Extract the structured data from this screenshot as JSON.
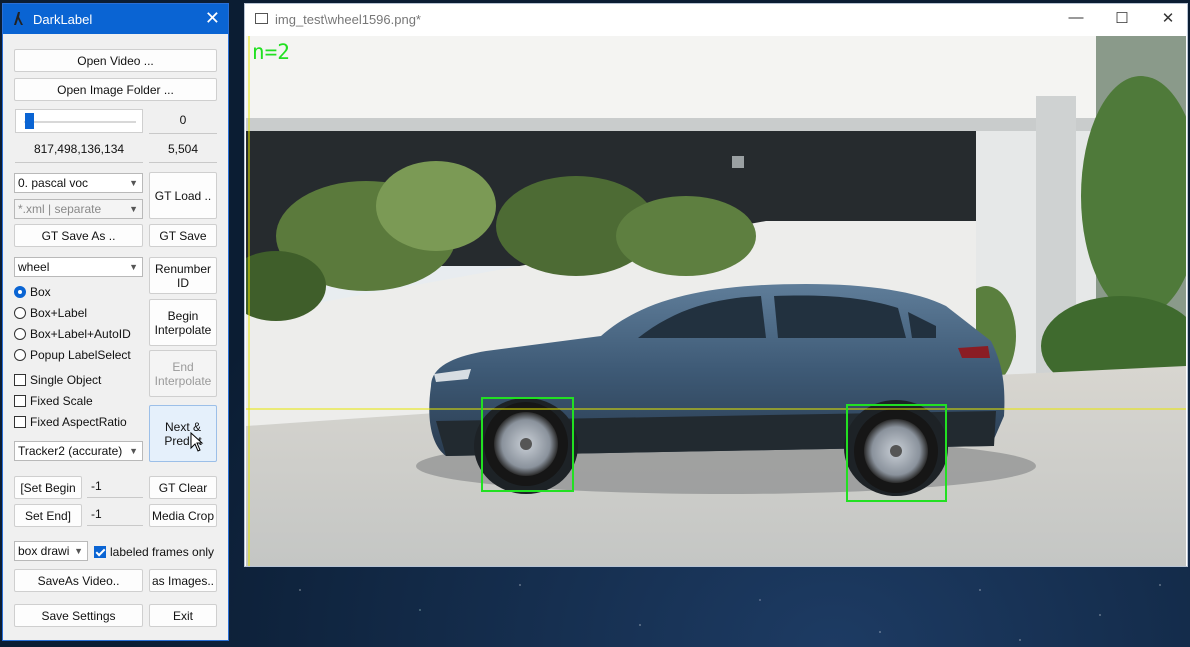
{
  "app": {
    "title": "DarkLabel",
    "close": "✕"
  },
  "buttons": {
    "open_video": "Open Video ...",
    "open_image_folder": "Open Image Folder ...",
    "gt_load": "GT Load ..",
    "gt_save_as": "GT Save As ..",
    "gt_save": "GT Save",
    "renumber_id": "Renumber ID",
    "begin_interpolate": "Begin Interpolate",
    "end_interpolate": "End Interpolate",
    "next_predict": "Next & Predict",
    "set_begin": "[Set Begin",
    "set_end": "Set End]",
    "gt_clear": "GT Clear",
    "media_crop": "Media Crop",
    "save_as_video": "SaveAs Video..",
    "as_images": "as Images..",
    "save_settings": "Save Settings",
    "exit": "Exit"
  },
  "frame": {
    "index": "0",
    "range": "817,498,136,134",
    "total": "5,504",
    "position_fraction": 0.0
  },
  "combos": {
    "format": "0. pascal voc",
    "file_mode": "*.xml | separate",
    "label": "wheel",
    "tracker": "Tracker2 (accurate)",
    "draw_mode": "box drawi"
  },
  "fields": {
    "begin": "-1",
    "end": "-1"
  },
  "radios": [
    "Box",
    "Box+Label",
    "Box+Label+AutoID",
    "Popup LabelSelect"
  ],
  "radio_selected": 0,
  "checks": [
    {
      "label": "Single Object",
      "checked": false
    },
    {
      "label": "Fixed Scale",
      "checked": false
    },
    {
      "label": "Fixed AspectRatio",
      "checked": false
    }
  ],
  "labeled_frames": {
    "label": "labeled frames only",
    "checked": true
  },
  "image_window": {
    "title": "img_test\\wheel1596.png*",
    "minimize": "—",
    "maximize": "☐",
    "close": "✕",
    "count": "n=2"
  },
  "colors": {
    "accent": "#0a64d3",
    "bbox": "#22e022",
    "guide": "#e8e800"
  }
}
